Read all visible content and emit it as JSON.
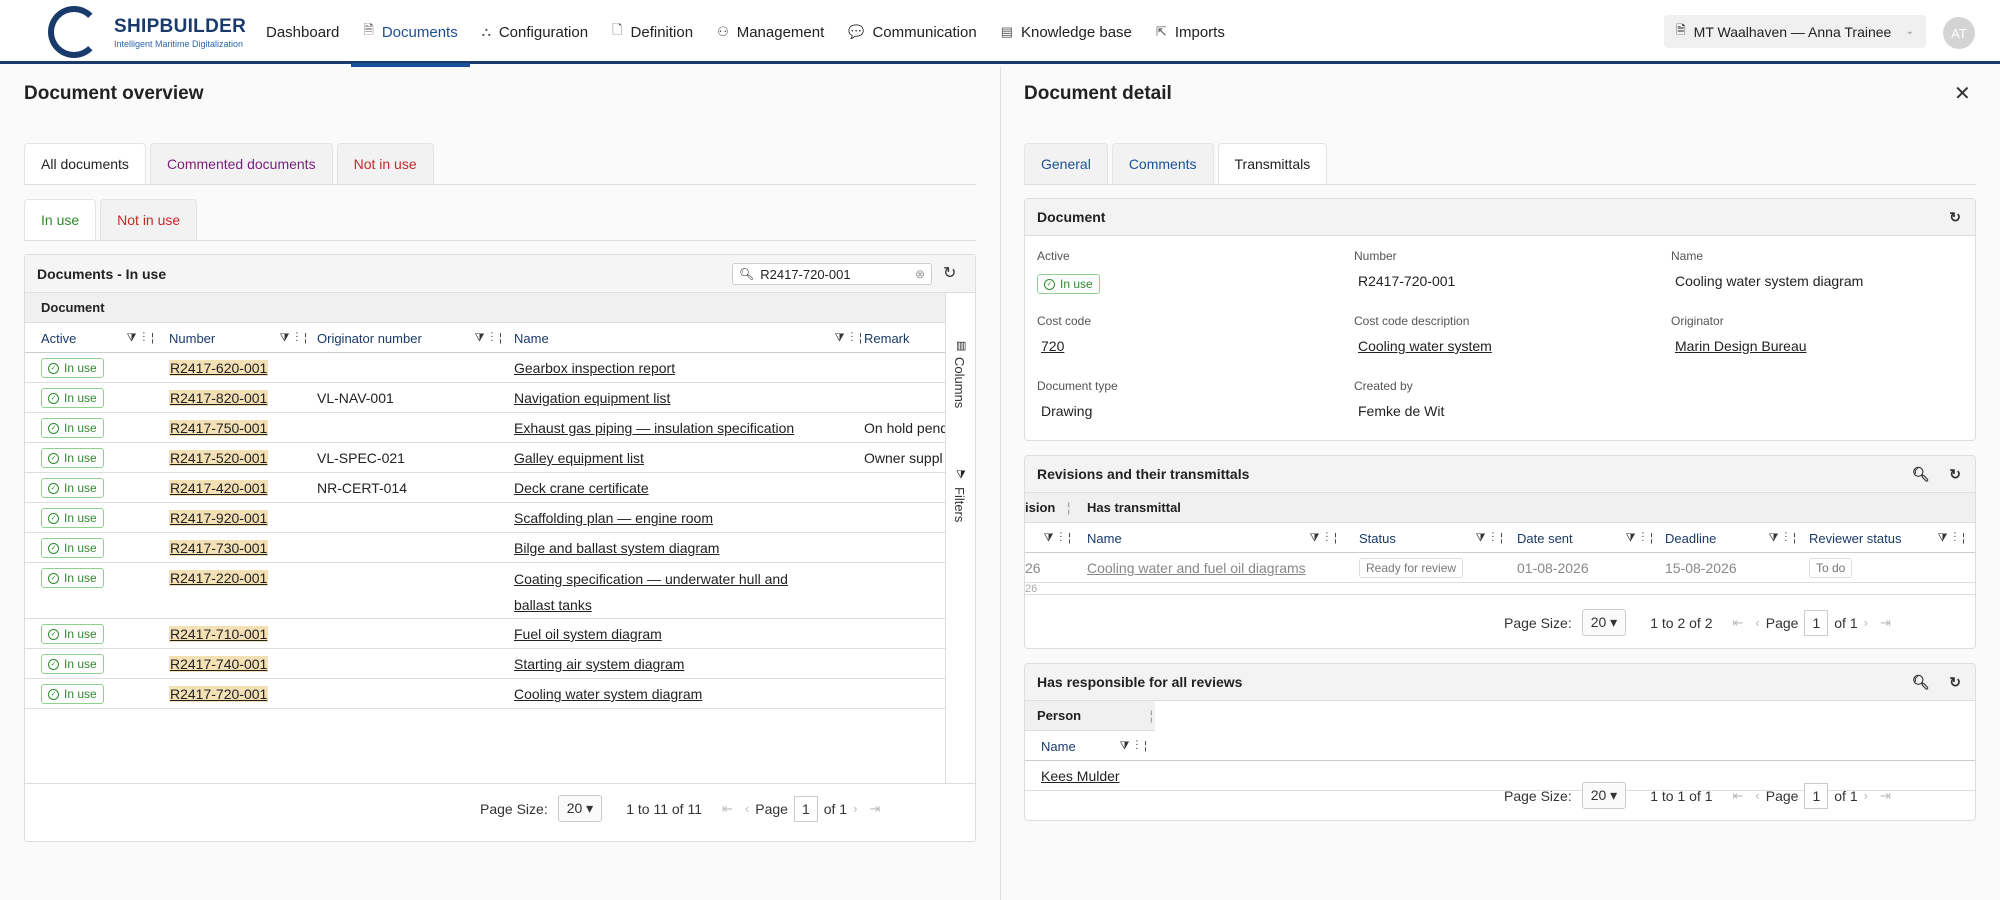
{
  "brand": {
    "title": "SHIPBUILDER",
    "subtitle": "Intelligent Maritime Digitalization"
  },
  "nav": [
    {
      "label": "Dashboard",
      "icon": "",
      "active": false
    },
    {
      "label": "Documents",
      "icon": "document-icon",
      "active": true
    },
    {
      "label": "Configuration",
      "icon": "hierarchy-icon",
      "active": false
    },
    {
      "label": "Definition",
      "icon": "document-icon",
      "active": false
    },
    {
      "label": "Management",
      "icon": "person-icon",
      "active": false
    },
    {
      "label": "Communication",
      "icon": "chat-icon",
      "active": false
    },
    {
      "label": "Knowledge base",
      "icon": "book-icon",
      "active": false
    },
    {
      "label": "Imports",
      "icon": "import-icon",
      "active": false
    }
  ],
  "ship_select": "MT Waalhaven — Anna Trainee",
  "avatar": "AT",
  "overview": {
    "title": "Document overview",
    "tabs": [
      "All documents",
      "Commented documents",
      "Not in use"
    ],
    "subtabs": [
      "In use",
      "Not in use"
    ],
    "grid_title": "Documents - In use",
    "search_value": "R2417-720-001",
    "group_label": "Document",
    "columns": [
      "Active",
      "Number",
      "Originator number",
      "Name",
      "Remark"
    ],
    "rows": [
      {
        "status": "In use",
        "number": "R2417-620-001",
        "originator": "",
        "name": "Gearbox inspection report",
        "remark": ""
      },
      {
        "status": "In use",
        "number": "R2417-820-001",
        "originator": "VL-NAV-001",
        "name": "Navigation equipment list",
        "remark": ""
      },
      {
        "status": "In use",
        "number": "R2417-750-001",
        "originator": "",
        "name": "Exhaust gas piping — insulation specification",
        "remark": "On hold pend"
      },
      {
        "status": "In use",
        "number": "R2417-520-001",
        "originator": "VL-SPEC-021",
        "name": "Galley equipment list",
        "remark": "Owner suppl"
      },
      {
        "status": "In use",
        "number": "R2417-420-001",
        "originator": "NR-CERT-014",
        "name": "Deck crane certificate",
        "remark": ""
      },
      {
        "status": "In use",
        "number": "R2417-920-001",
        "originator": "",
        "name": "Scaffolding plan — engine room",
        "remark": ""
      },
      {
        "status": "In use",
        "number": "R2417-730-001",
        "originator": "",
        "name": "Bilge and ballast system diagram",
        "remark": ""
      },
      {
        "status": "In use",
        "number": "R2417-220-001",
        "originator": "",
        "name": "Coating specification — underwater hull and ballast tanks",
        "remark": ""
      },
      {
        "status": "In use",
        "number": "R2417-710-001",
        "originator": "",
        "name": "Fuel oil system diagram",
        "remark": ""
      },
      {
        "status": "In use",
        "number": "R2417-740-001",
        "originator": "",
        "name": "Starting air system diagram",
        "remark": ""
      },
      {
        "status": "In use",
        "number": "R2417-720-001",
        "originator": "",
        "name": "Cooling water system diagram",
        "remark": ""
      }
    ],
    "side_columns": "Columns",
    "side_filters": "Filters",
    "pager": {
      "label": "Page Size:",
      "size": "20",
      "range": "1 to 11 of 11",
      "page_label": "Page",
      "page": "1",
      "of": "of 1"
    }
  },
  "detail": {
    "title": "Document detail",
    "tabs": [
      "General",
      "Comments",
      "Transmittals"
    ],
    "doc_card_title": "Document",
    "fields": {
      "active_label": "Active",
      "active_value": "In use",
      "number_label": "Number",
      "number_value": "R2417-720-001",
      "name_label": "Name",
      "name_value": "Cooling water system diagram",
      "cost_code_label": "Cost code",
      "cost_code_value": "720",
      "cost_desc_label": "Cost code description",
      "cost_desc_value": "Cooling water system",
      "originator_label": "Originator",
      "originator_value": "Marin Design Bureau",
      "doctype_label": "Document type",
      "doctype_value": "Drawing",
      "created_label": "Created by",
      "created_value": "Femke de Wit"
    },
    "revisions": {
      "title": "Revisions and their transmittals",
      "group_left": "ision",
      "group_right": "Has transmittal",
      "columns": [
        "Name",
        "Status",
        "Date sent",
        "Deadline",
        "Reviewer status"
      ],
      "row": {
        "left": "26",
        "name": "Cooling water and fuel oil diagrams",
        "status": "Ready for review",
        "date_sent": "01-08-2026",
        "deadline": "15-08-2026",
        "reviewer_status": "To do"
      },
      "row2_left": "26",
      "pager": {
        "label": "Page Size:",
        "size": "20",
        "range": "1 to 2 of 2",
        "page_label": "Page",
        "page": "1",
        "of": "of 1"
      }
    },
    "responsible": {
      "title": "Has responsible for all reviews",
      "group": "Person",
      "column": "Name",
      "person": "Kees Mulder",
      "pager": {
        "label": "Page Size:",
        "size": "20",
        "range": "1 to 1 of 1",
        "page_label": "Page",
        "page": "1",
        "of": "of 1"
      }
    }
  },
  "colors": {
    "brand": "#1a3a6b",
    "accent": "#1a4f9c",
    "ok": "#2e8b2e",
    "danger": "#c62828",
    "purple": "#7b1f7b"
  }
}
